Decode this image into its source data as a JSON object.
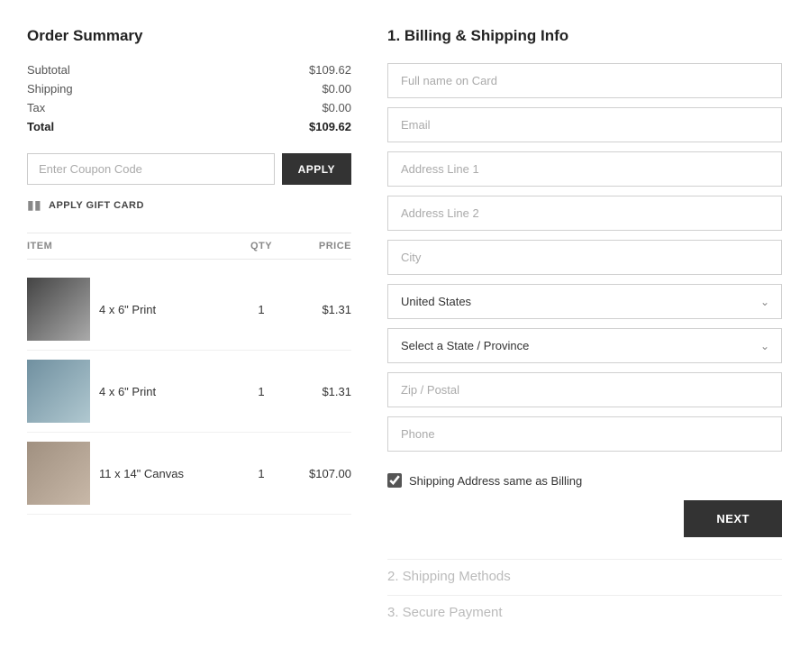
{
  "left": {
    "title": "Order Summary",
    "subtotal_label": "Subtotal",
    "subtotal_value": "$109.62",
    "shipping_label": "Shipping",
    "shipping_value": "$0.00",
    "tax_label": "Tax",
    "tax_value": "$0.00",
    "total_label": "Total",
    "total_value": "$109.62",
    "coupon_placeholder": "Enter Coupon Code",
    "apply_label": "APPLY",
    "gift_card_label": "APPLY GIFT CARD",
    "table_headers": {
      "item": "ITEM",
      "qty": "QTY",
      "price": "PRICE"
    },
    "items": [
      {
        "name": "4 x 6\" Print",
        "qty": "1",
        "price": "$1.31",
        "thumb_class": "thumb-dark"
      },
      {
        "name": "4 x 6\" Print",
        "qty": "1",
        "price": "$1.31",
        "thumb_class": "thumb-light"
      },
      {
        "name": "11 x 14\" Canvas",
        "qty": "1",
        "price": "$107.00",
        "thumb_class": "thumb-warm"
      }
    ]
  },
  "right": {
    "billing_title": "1. Billing & Shipping Info",
    "fields": {
      "full_name_placeholder": "Full name on Card",
      "email_placeholder": "Email",
      "address1_placeholder": "Address Line 1",
      "address2_placeholder": "Address Line 2",
      "city_placeholder": "City",
      "zip_placeholder": "Zip / Postal",
      "phone_placeholder": "Phone"
    },
    "country_value": "United States",
    "state_placeholder": "Select a State / Province",
    "shipping_same_label": "Shipping Address same as Billing",
    "next_label": "NEXT",
    "step2_label": "2. Shipping Methods",
    "step3_label": "3. Secure Payment"
  }
}
